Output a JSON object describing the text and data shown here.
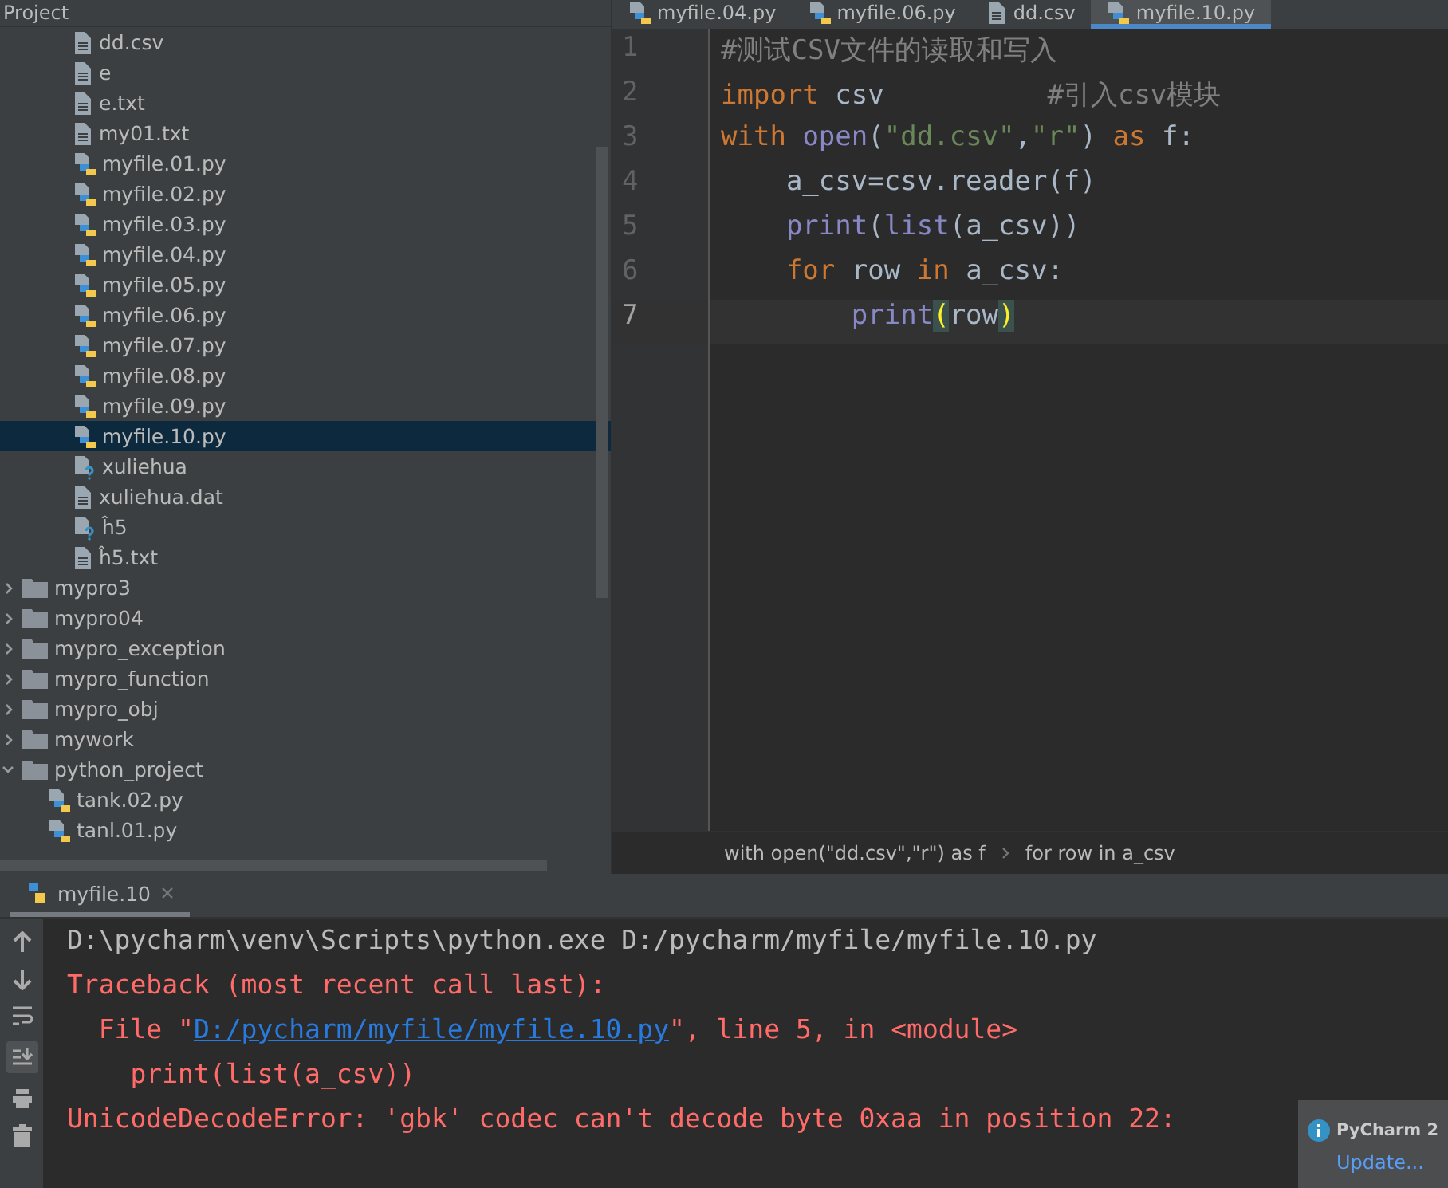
{
  "project_panel": {
    "title": "Project",
    "tree": [
      {
        "children": [
          {
            "name": "dd.csv",
            "kind": "text",
            "selected": false
          },
          {
            "name": "e",
            "kind": "text",
            "selected": false
          },
          {
            "name": "e.txt",
            "kind": "text",
            "selected": false
          },
          {
            "name": "my01.txt",
            "kind": "text",
            "selected": false
          },
          {
            "name": "myfile.01.py",
            "kind": "python",
            "selected": false
          },
          {
            "name": "myfile.02.py",
            "kind": "python",
            "selected": false
          },
          {
            "name": "myfile.03.py",
            "kind": "python",
            "selected": false
          },
          {
            "name": "myfile.04.py",
            "kind": "python",
            "selected": false
          },
          {
            "name": "myfile.05.py",
            "kind": "python",
            "selected": false
          },
          {
            "name": "myfile.06.py",
            "kind": "python",
            "selected": false
          },
          {
            "name": "myfile.07.py",
            "kind": "python",
            "selected": false
          },
          {
            "name": "myfile.08.py",
            "kind": "python",
            "selected": false
          },
          {
            "name": "myfile.09.py",
            "kind": "python",
            "selected": false
          },
          {
            "name": "myfile.10.py",
            "kind": "python",
            "selected": true
          },
          {
            "name": "xuliehua",
            "kind": "unknown",
            "selected": false
          },
          {
            "name": "xuliehua.dat",
            "kind": "text",
            "selected": false
          },
          {
            "name": "ĥ5",
            "kind": "unknown",
            "selected": false
          },
          {
            "name": "ĥ5.txt",
            "kind": "text",
            "selected": false
          }
        ]
      },
      {
        "name": "mypro3",
        "kind": "folder",
        "expanded": false,
        "selected": false
      },
      {
        "name": "mypro04",
        "kind": "folder",
        "expanded": false,
        "selected": false
      },
      {
        "name": "mypro_exception",
        "kind": "folder",
        "expanded": false,
        "selected": false
      },
      {
        "name": "mypro_function",
        "kind": "folder",
        "expanded": false,
        "selected": false
      },
      {
        "name": "mypro_obj",
        "kind": "folder",
        "expanded": false,
        "selected": false
      },
      {
        "name": "mywork",
        "kind": "folder",
        "expanded": false,
        "selected": false
      },
      {
        "name": "python_project",
        "kind": "folder",
        "expanded": true,
        "selected": false,
        "children": [
          {
            "name": "tank.02.py",
            "kind": "python",
            "selected": false
          },
          {
            "name": "tanl.01.py",
            "kind": "python",
            "selected": false
          }
        ]
      }
    ]
  },
  "editor_tabs": [
    {
      "label": "myfile.04.py",
      "kind": "python",
      "selected": false
    },
    {
      "label": "myfile.06.py",
      "kind": "python",
      "selected": false
    },
    {
      "label": "dd.csv",
      "kind": "text",
      "selected": false
    },
    {
      "label": "myfile.10.py",
      "kind": "python",
      "selected": true
    }
  ],
  "code_lines": [
    {
      "number": "1",
      "current": false,
      "segments": [
        {
          "text": "#测试CSV文件的读取和写入",
          "kind": "comment"
        }
      ]
    },
    {
      "number": "2",
      "current": false,
      "segments": [
        {
          "text": "import",
          "kind": "keyword"
        },
        {
          "text": " csv          ",
          "kind": "plain"
        },
        {
          "text": "#引入csv模块",
          "kind": "comment"
        }
      ]
    },
    {
      "number": "3",
      "current": false,
      "segments": [
        {
          "text": "with",
          "kind": "keyword"
        },
        {
          "text": " open",
          "kind": "builtin"
        },
        {
          "text": "(",
          "kind": "plain"
        },
        {
          "text": "\"dd.csv\"",
          "kind": "string"
        },
        {
          "text": ",",
          "kind": "plain"
        },
        {
          "text": "\"r\"",
          "kind": "string"
        },
        {
          "text": ") ",
          "kind": "plain"
        },
        {
          "text": "as",
          "kind": "keyword"
        },
        {
          "text": " f:",
          "kind": "plain"
        }
      ]
    },
    {
      "number": "4",
      "current": false,
      "segments": [
        {
          "text": "    a_csv=csv.reader(f)",
          "kind": "plain"
        }
      ]
    },
    {
      "number": "5",
      "current": false,
      "segments": [
        {
          "text": "    print",
          "kind": "builtin"
        },
        {
          "text": "(",
          "kind": "plain"
        },
        {
          "text": "list",
          "kind": "builtin"
        },
        {
          "text": "(a_csv))",
          "kind": "plain"
        }
      ]
    },
    {
      "number": "6",
      "current": false,
      "segments": [
        {
          "text": "    for",
          "kind": "keyword"
        },
        {
          "text": " row ",
          "kind": "plain"
        },
        {
          "text": "in",
          "kind": "keyword"
        },
        {
          "text": " a_csv:",
          "kind": "plain"
        }
      ]
    },
    {
      "number": "7",
      "current": true,
      "segments": [
        {
          "text": "        print",
          "kind": "builtin"
        },
        {
          "text": "(",
          "kind": "brace"
        },
        {
          "text": "row",
          "kind": "plain"
        },
        {
          "text": ")",
          "kind": "brace"
        }
      ]
    }
  ],
  "breadcrumbs": [
    "with open(\"dd.csv\",\"r\") as f",
    "for row in a_csv"
  ],
  "run_panel": {
    "tab": "myfile.10",
    "lines": [
      {
        "kind": "command",
        "segments": [
          {
            "text": "D:\\pycharm\\venv\\Scripts\\python.exe D:/pycharm/myfile/myfile.10.py",
            "kind": "plain"
          }
        ]
      },
      {
        "kind": "error",
        "segments": [
          {
            "text": "Traceback (most recent call last):",
            "kind": "plain"
          }
        ]
      },
      {
        "kind": "error",
        "segments": [
          {
            "text": "  File \"",
            "kind": "plain"
          },
          {
            "text": "D:/pycharm/myfile/myfile.10.py",
            "kind": "link"
          },
          {
            "text": "\", line 5, in <module>",
            "kind": "plain"
          }
        ]
      },
      {
        "kind": "error",
        "segments": [
          {
            "text": "    print(list(a_csv))",
            "kind": "plain"
          }
        ]
      },
      {
        "kind": "error",
        "segments": [
          {
            "text": "UnicodeDecodeError: 'gbk' codec can't decode byte 0xaa in position 22:",
            "kind": "plain"
          }
        ]
      }
    ]
  },
  "notification": {
    "title": "PyCharm 2",
    "action": "Update..."
  }
}
